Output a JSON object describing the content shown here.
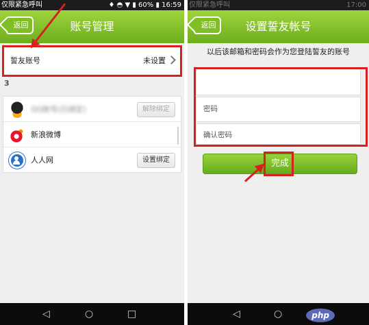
{
  "left_screen": {
    "status": {
      "left": "仅限紧急呼叫",
      "battery": "60%",
      "time": "16:59"
    },
    "header": {
      "back_label": "返回",
      "title": "账号管理"
    },
    "friend_account": {
      "label": "誓友账号",
      "value": "未设置"
    },
    "stray_char": "3",
    "bindings": [
      {
        "icon": "qq-icon",
        "name": "QQ账号(已绑定)",
        "action": "解除绑定",
        "enabled": false
      },
      {
        "icon": "weibo-icon",
        "name": "新浪微博",
        "action": ""
      },
      {
        "icon": "renren-icon",
        "name": "人人网",
        "action": "设置绑定",
        "enabled": true
      }
    ]
  },
  "right_screen": {
    "status": {
      "left": "仅限紧急呼叫",
      "time": "17:00"
    },
    "header": {
      "back_label": "返回",
      "title": "设置誓友帐号"
    },
    "hint": "以后该邮箱和密码会作为您登陆誓友的账号",
    "fields": {
      "email_placeholder": "",
      "password_placeholder": "密码",
      "confirm_placeholder": "确认密码"
    },
    "done_label": "完成"
  },
  "watermark": "php",
  "colors": {
    "brand_green": "#7fbe25",
    "annotation_red": "#d6221f",
    "status_bar": "#1c1c1c"
  }
}
